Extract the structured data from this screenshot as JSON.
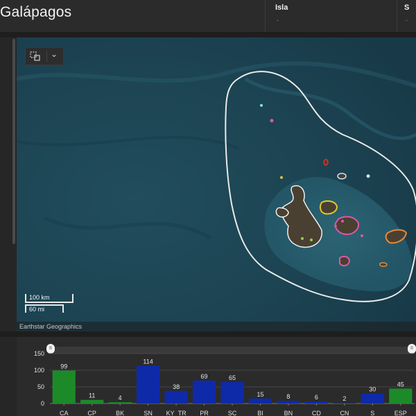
{
  "header": {
    "title": "Galápagos",
    "panels": [
      {
        "label": "Isla",
        "value": "-"
      },
      {
        "label": "S",
        "value": "-"
      }
    ]
  },
  "map": {
    "basemap_attribution": "Earthstar Geographics",
    "scale": {
      "metric": "100 km",
      "imperial": "60 mi"
    },
    "toolbar": {
      "select_icon": "select-tool-icon",
      "dropdown_icon": "chevron-down-icon"
    }
  },
  "chart_data": {
    "type": "bar",
    "categories": [
      "CA",
      "CP",
      "BK",
      "SN",
      "KY_TR",
      "PR",
      "SC",
      "BI",
      "BN",
      "CD",
      "CN",
      "S",
      "ESP"
    ],
    "values": [
      99,
      11,
      4,
      114,
      38,
      69,
      65,
      15,
      8,
      6,
      2,
      30,
      45
    ],
    "colors": [
      "#1d8a2a",
      "#1d8a2a",
      "#1d8a2a",
      "#0f2aa8",
      "#0f2aa8",
      "#0f2aa8",
      "#0f2aa8",
      "#0f2aa8",
      "#0f2aa8",
      "#0f2aa8",
      "#0f2aa8",
      "#0f2aa8",
      "#1d8a2a"
    ],
    "yticks": [
      0,
      50,
      100,
      150
    ],
    "ylim": [
      0,
      150
    ],
    "grid": true
  }
}
